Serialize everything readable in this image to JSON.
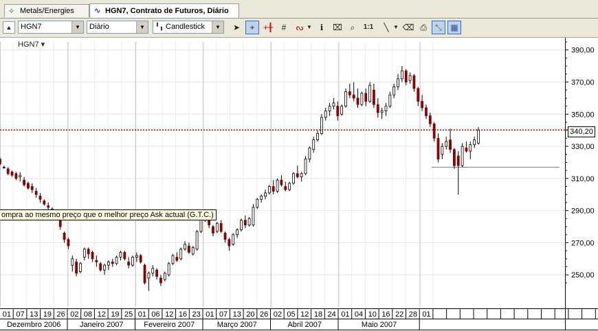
{
  "tabs": [
    {
      "label": "Metals/Energies",
      "icon": "metals-tab-icon"
    },
    {
      "label": "HGN7, Contrato de Futuros, Diário",
      "icon": "chart-tab-icon"
    }
  ],
  "toolbar": {
    "symbol": "HGN7",
    "period": "Diário",
    "chart_style": "Candlestick",
    "zoom_label": "1:1"
  },
  "chart_symbol": "HGN7 ▾",
  "tooltip": "ompra ao mesmo preço que o melhor preço Ask actual (G.T.C.)",
  "colors": {
    "up": "#ffffff",
    "down": "#8b0000",
    "price_line": "#cc0000",
    "order_line": "#808080"
  },
  "chart_data": {
    "type": "candlestick",
    "ylim": [
      230,
      395
    ],
    "y_ticks": [
      "390,00",
      "370,00",
      "350,00",
      "330,00",
      "310,00",
      "290,00",
      "270,00",
      "250,00"
    ],
    "y_tick_values": [
      390,
      370,
      350,
      330,
      310,
      290,
      270,
      250
    ],
    "day_labels": [
      "01",
      "07",
      "13",
      "19",
      "26",
      "02",
      "08",
      "12",
      "19",
      "25",
      "01",
      "06",
      "12",
      "16",
      "23",
      "01",
      "07",
      "13",
      "20",
      "26",
      "02",
      "05",
      "12",
      "18",
      "24",
      "01",
      "04",
      "10",
      "16",
      "22",
      "28",
      "01"
    ],
    "month_labels": [
      "Dezembro 2006",
      "Janeiro 2007",
      "Fevereiro 2007",
      "Março 2007",
      "Abril 2007",
      "Maio 2007"
    ],
    "current_price": 340.2,
    "current_price_label": "340,20",
    "order_line_price": 317,
    "candles": [
      [
        322,
        323,
        318,
        319
      ],
      [
        317,
        318,
        316,
        317
      ],
      [
        316,
        317,
        312,
        313
      ],
      [
        314,
        315,
        311,
        312
      ],
      [
        313,
        314,
        309,
        310
      ],
      [
        311,
        314,
        308,
        312
      ],
      [
        309,
        311,
        305,
        306
      ],
      [
        307,
        308,
        303,
        304
      ],
      [
        305,
        307,
        301,
        303
      ],
      [
        302,
        304,
        298,
        300
      ],
      [
        299,
        301,
        295,
        297
      ],
      [
        296,
        297,
        293,
        294
      ],
      [
        293,
        295,
        289,
        292
      ],
      [
        291,
        292,
        286,
        288
      ],
      [
        289,
        290,
        286,
        287
      ],
      [
        286,
        288,
        278,
        280
      ],
      [
        276,
        277,
        270,
        272
      ],
      [
        272,
        273,
        266,
        268
      ],
      [
        256,
        262,
        252,
        260
      ],
      [
        258,
        260,
        249,
        251
      ],
      [
        252,
        258,
        251,
        257
      ],
      [
        261,
        267,
        259,
        266
      ],
      [
        266,
        267,
        260,
        263
      ],
      [
        264,
        265,
        258,
        260
      ],
      [
        259,
        262,
        255,
        258
      ],
      [
        257,
        258,
        252,
        253
      ],
      [
        253,
        257,
        250,
        256
      ],
      [
        256,
        259,
        253,
        258
      ],
      [
        258,
        260,
        255,
        257
      ],
      [
        257,
        262,
        256,
        261
      ],
      [
        261,
        265,
        259,
        264
      ],
      [
        264,
        265,
        259,
        260
      ],
      [
        258,
        261,
        254,
        256
      ],
      [
        256,
        262,
        255,
        261
      ],
      [
        261,
        264,
        258,
        262
      ],
      [
        262,
        263,
        257,
        258
      ],
      [
        256,
        257,
        244,
        245
      ],
      [
        248,
        252,
        240,
        251
      ],
      [
        251,
        256,
        249,
        254
      ],
      [
        253,
        254,
        247,
        249
      ],
      [
        248,
        250,
        243,
        245
      ],
      [
        247,
        252,
        246,
        251
      ],
      [
        250,
        258,
        249,
        257
      ],
      [
        257,
        263,
        256,
        262
      ],
      [
        261,
        264,
        258,
        259
      ],
      [
        260,
        267,
        259,
        266
      ],
      [
        266,
        271,
        265,
        269
      ],
      [
        268,
        270,
        263,
        264
      ],
      [
        263,
        268,
        262,
        267
      ],
      [
        266,
        278,
        265,
        277
      ],
      [
        277,
        288,
        276,
        286
      ],
      [
        285,
        290,
        283,
        288
      ],
      [
        284,
        286,
        279,
        281
      ],
      [
        280,
        281,
        274,
        276
      ],
      [
        277,
        283,
        276,
        282
      ],
      [
        282,
        284,
        276,
        277
      ],
      [
        276,
        277,
        270,
        272
      ],
      [
        272,
        273,
        265,
        268
      ],
      [
        269,
        276,
        268,
        275
      ],
      [
        275,
        279,
        273,
        278
      ],
      [
        278,
        285,
        277,
        284
      ],
      [
        284,
        287,
        279,
        281
      ],
      [
        281,
        286,
        280,
        285
      ],
      [
        281,
        294,
        280,
        292
      ],
      [
        292,
        298,
        291,
        297
      ],
      [
        297,
        300,
        295,
        299
      ],
      [
        299,
        303,
        297,
        301
      ],
      [
        301,
        306,
        300,
        305
      ],
      [
        305,
        309,
        300,
        302
      ],
      [
        302,
        310,
        301,
        309
      ],
      [
        309,
        312,
        305,
        306
      ],
      [
        305,
        308,
        302,
        303
      ],
      [
        303,
        308,
        302,
        307
      ],
      [
        307,
        314,
        306,
        313
      ],
      [
        313,
        318,
        310,
        311
      ],
      [
        311,
        314,
        308,
        313
      ],
      [
        313,
        324,
        312,
        322
      ],
      [
        322,
        330,
        320,
        329
      ],
      [
        328,
        336,
        326,
        334
      ],
      [
        334,
        340,
        333,
        338
      ],
      [
        338,
        350,
        337,
        348
      ],
      [
        348,
        354,
        346,
        352
      ],
      [
        352,
        357,
        349,
        355
      ],
      [
        355,
        360,
        353,
        357
      ],
      [
        355,
        358,
        346,
        349
      ],
      [
        350,
        356,
        349,
        355
      ],
      [
        355,
        366,
        354,
        364
      ],
      [
        364,
        369,
        360,
        362
      ],
      [
        362,
        370,
        358,
        360
      ],
      [
        360,
        366,
        354,
        356
      ],
      [
        356,
        364,
        355,
        363
      ],
      [
        363,
        366,
        355,
        358
      ],
      [
        358,
        370,
        357,
        368
      ],
      [
        365,
        369,
        354,
        356
      ],
      [
        356,
        360,
        348,
        351
      ],
      [
        351,
        354,
        347,
        352
      ],
      [
        352,
        357,
        349,
        355
      ],
      [
        355,
        364,
        354,
        362
      ],
      [
        362,
        369,
        360,
        367
      ],
      [
        367,
        375,
        365,
        372
      ],
      [
        372,
        380,
        370,
        377
      ],
      [
        377,
        378,
        368,
        370
      ],
      [
        371,
        376,
        369,
        374
      ],
      [
        374,
        375,
        364,
        366
      ],
      [
        366,
        367,
        355,
        358
      ],
      [
        358,
        362,
        352,
        354
      ],
      [
        354,
        356,
        347,
        349
      ],
      [
        349,
        351,
        342,
        344
      ],
      [
        344,
        345,
        333,
        335
      ],
      [
        335,
        338,
        320,
        322
      ],
      [
        325,
        332,
        322,
        330
      ],
      [
        330,
        336,
        328,
        333
      ],
      [
        334,
        341,
        326,
        328
      ],
      [
        328,
        329,
        316,
        318
      ],
      [
        324,
        327,
        300,
        318
      ],
      [
        318,
        332,
        317,
        330
      ],
      [
        329,
        333,
        326,
        327
      ],
      [
        327,
        333,
        322,
        331
      ],
      [
        331,
        336,
        329,
        334
      ],
      [
        332,
        342,
        331,
        340
      ]
    ]
  }
}
